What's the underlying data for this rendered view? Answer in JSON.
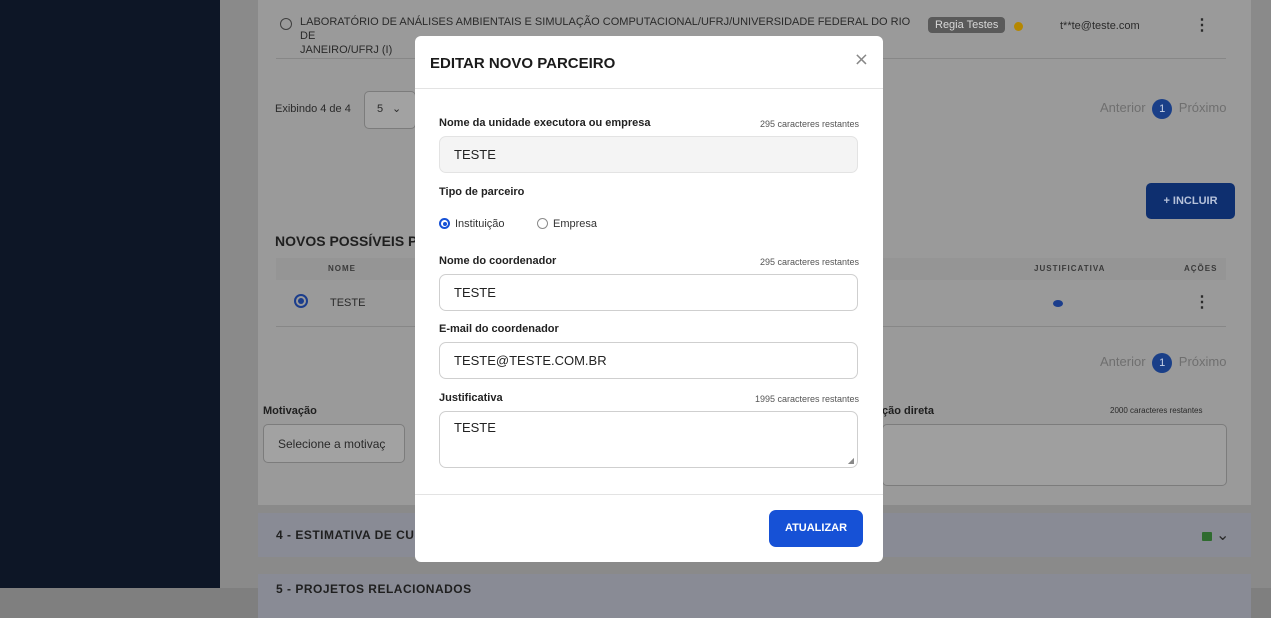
{
  "background": {
    "row1": {
      "name": "LABORATÓRIO DE ANÁLISES AMBIENTAIS E SIMULAÇÃO COMPUTACIONAL/UFRJ/UNIVERSIDADE FEDERAL DO RIO DE",
      "name_line2": "JANEIRO/UFRJ (I)",
      "badge": "Regia Testes",
      "email": "t**te@teste.com"
    },
    "pagination_top": {
      "showing": "Exibindo 4 de 4",
      "page_size": "5",
      "prev": "Anterior",
      "page": "1",
      "next": "Próximo"
    },
    "include_button": "+ INCLUIR",
    "section_title": "NOVOS POSSÍVEIS PA",
    "table": {
      "col_name": "NOME",
      "col_justificativa": "JUSTIFICATIVA",
      "col_acoes": "AÇÕES",
      "row_name": "TESTE"
    },
    "pagination_bottom": {
      "prev": "Anterior",
      "page": "1",
      "next": "Próximo"
    },
    "motivacao_label": "Motivação",
    "motivacao_placeholder": "Selecione a motivaç",
    "contratacao_label": "ção direta",
    "contratacao_counter": "2000 caracteres restantes",
    "accordion_4": "4 - ESTIMATIVA DE CUS",
    "accordion_5": "5 - PROJETOS RELACIONADOS"
  },
  "modal": {
    "title": "EDITAR NOVO PARCEIRO",
    "close_icon": "×",
    "field_unit": {
      "label": "Nome da unidade executora ou empresa",
      "counter": "295 caracteres restantes",
      "value": "TESTE"
    },
    "tipo": {
      "label": "Tipo de parceiro",
      "option1": "Instituição",
      "option2": "Empresa",
      "selected": "Instituição"
    },
    "coordenador": {
      "label": "Nome do coordenador",
      "counter": "295 caracteres restantes",
      "value": "TESTE"
    },
    "email": {
      "label": "E-mail do coordenador",
      "value": "TESTE@TESTE.COM.BR"
    },
    "justificativa": {
      "label": "Justificativa",
      "counter": "1995 caracteres restantes",
      "value": "TESTE"
    },
    "submit": "ATUALIZAR"
  },
  "colors": {
    "primary": "#1651d6",
    "sidebar": "#0d1626",
    "overlay": "#7f7f7f"
  }
}
